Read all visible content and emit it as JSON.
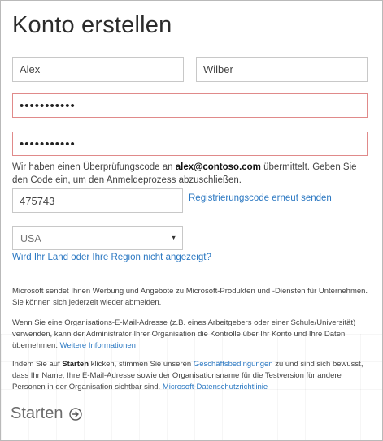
{
  "title": "Konto erstellen",
  "form": {
    "first_name": "Alex",
    "last_name": "Wilber",
    "password": "•••••••••••",
    "password_confirm": "•••••••••••",
    "code_info_before": "Wir haben einen Überprüfungscode an ",
    "code_info_email": "alex@contoso.com",
    "code_info_after": " übermittelt. Geben Sie den Code ein, um den Anmeldeprozess abzuschließen.",
    "verification_code": "475743",
    "resend_link": "Registrierungscode erneut senden",
    "country": "USA",
    "region_link": "Wird Ihr Land oder Ihre Region nicht angezeigt?"
  },
  "legal": {
    "p1": "Microsoft sendet Ihnen Werbung und Angebote zu Microsoft-Produkten und -Diensten für Unternehmen. Sie können sich jederzeit wieder abmelden.",
    "p2": "Wenn Sie eine Organisations-E-Mail-Adresse (z.B. eines Arbeitgebers oder einer Schule/Universität) verwenden, kann der Administrator Ihrer Organisation die Kontrolle über Ihr Konto und Ihre Daten übernehmen. ",
    "p2_link": "Weitere Informationen",
    "p3_a": "Indem Sie auf ",
    "p3_bold": "Starten",
    "p3_b": " klicken, stimmen Sie unseren ",
    "p3_link1": "Geschäftsbedingungen",
    "p3_c": " zu und sind sich bewusst, dass Ihr Name, Ihre E-Mail-Adresse sowie der Organisationsname für die Testversion für andere Personen in der Organisation sichtbar sind. ",
    "p3_link2": "Microsoft-Datenschutzrichtlinie"
  },
  "start_label": "Starten",
  "icons": {
    "dropdown": "caret-down-icon",
    "start": "arrow-circle-right-icon"
  },
  "colors": {
    "link": "#2b78c2",
    "alert_border": "#e08a8a"
  }
}
